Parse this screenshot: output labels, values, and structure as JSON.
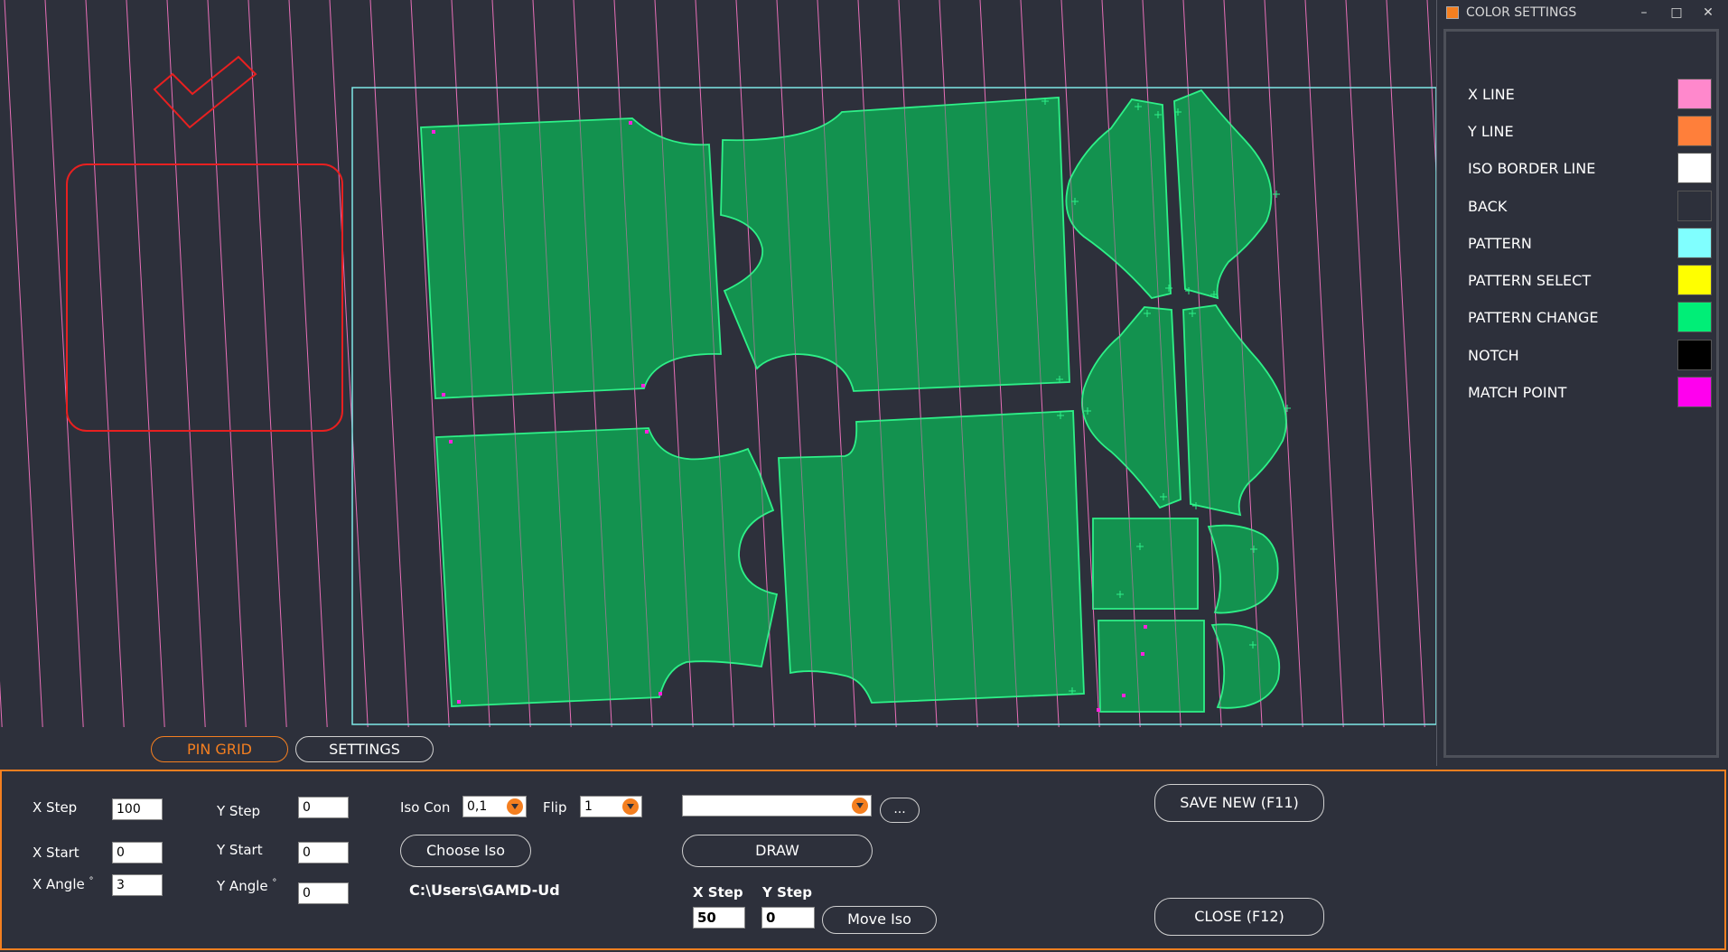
{
  "canvas": {
    "colors": {
      "stripe": "#e86fb8",
      "border": "#7ee8e8",
      "piece_fill": "#13924f",
      "piece_stroke": "#2ef088",
      "marker_red": "#e82020",
      "match_point": "#ff22dd"
    }
  },
  "tabs": {
    "pin_grid": "PIN GRID",
    "settings": "SETTINGS"
  },
  "settings": {
    "x_step_label": "X Step",
    "x_step": "100",
    "x_start_label": "X Start",
    "x_start": "0",
    "x_angle_label": "X Angle",
    "x_angle": "3",
    "y_step_label": "Y Step",
    "y_step": "0",
    "y_start_label": "Y Start",
    "y_start": "0",
    "y_angle_label": "Y Angle",
    "y_angle": "0",
    "degree_mark": "°",
    "iso_con_label": "Iso Con",
    "iso_con": "0,1",
    "flip_label": "Flip",
    "flip": "1",
    "choose_iso": "Choose Iso",
    "path": "C:\\Users\\GAMD-Ud",
    "file_select": "",
    "browse": "...",
    "draw": "DRAW",
    "move_x_step_label": "X Step",
    "move_x_step": "50",
    "move_y_step_label": "Y Step",
    "move_y_step": "0",
    "move_iso": "Move Iso",
    "save_new": "SAVE NEW (F11)",
    "close": "CLOSE (F12)"
  },
  "color_settings": {
    "title": "COLOR SETTINGS",
    "minimize": "–",
    "maximize": "□",
    "close": "✕",
    "items": [
      {
        "label": "X LINE",
        "color": "#ff88cc"
      },
      {
        "label": "Y LINE",
        "color": "#ff7f3a"
      },
      {
        "label": "ISO BORDER LINE",
        "color": "#ffffff"
      },
      {
        "label": "BACK",
        "color": "#2d303b"
      },
      {
        "label": "PATTERN",
        "color": "#80ffff"
      },
      {
        "label": "PATTERN SELECT",
        "color": "#ffff00"
      },
      {
        "label": "PATTERN CHANGE",
        "color": "#00ee77"
      },
      {
        "label": "NOTCH",
        "color": "#000000"
      },
      {
        "label": "MATCH POINT",
        "color": "#ff00ee"
      }
    ]
  }
}
